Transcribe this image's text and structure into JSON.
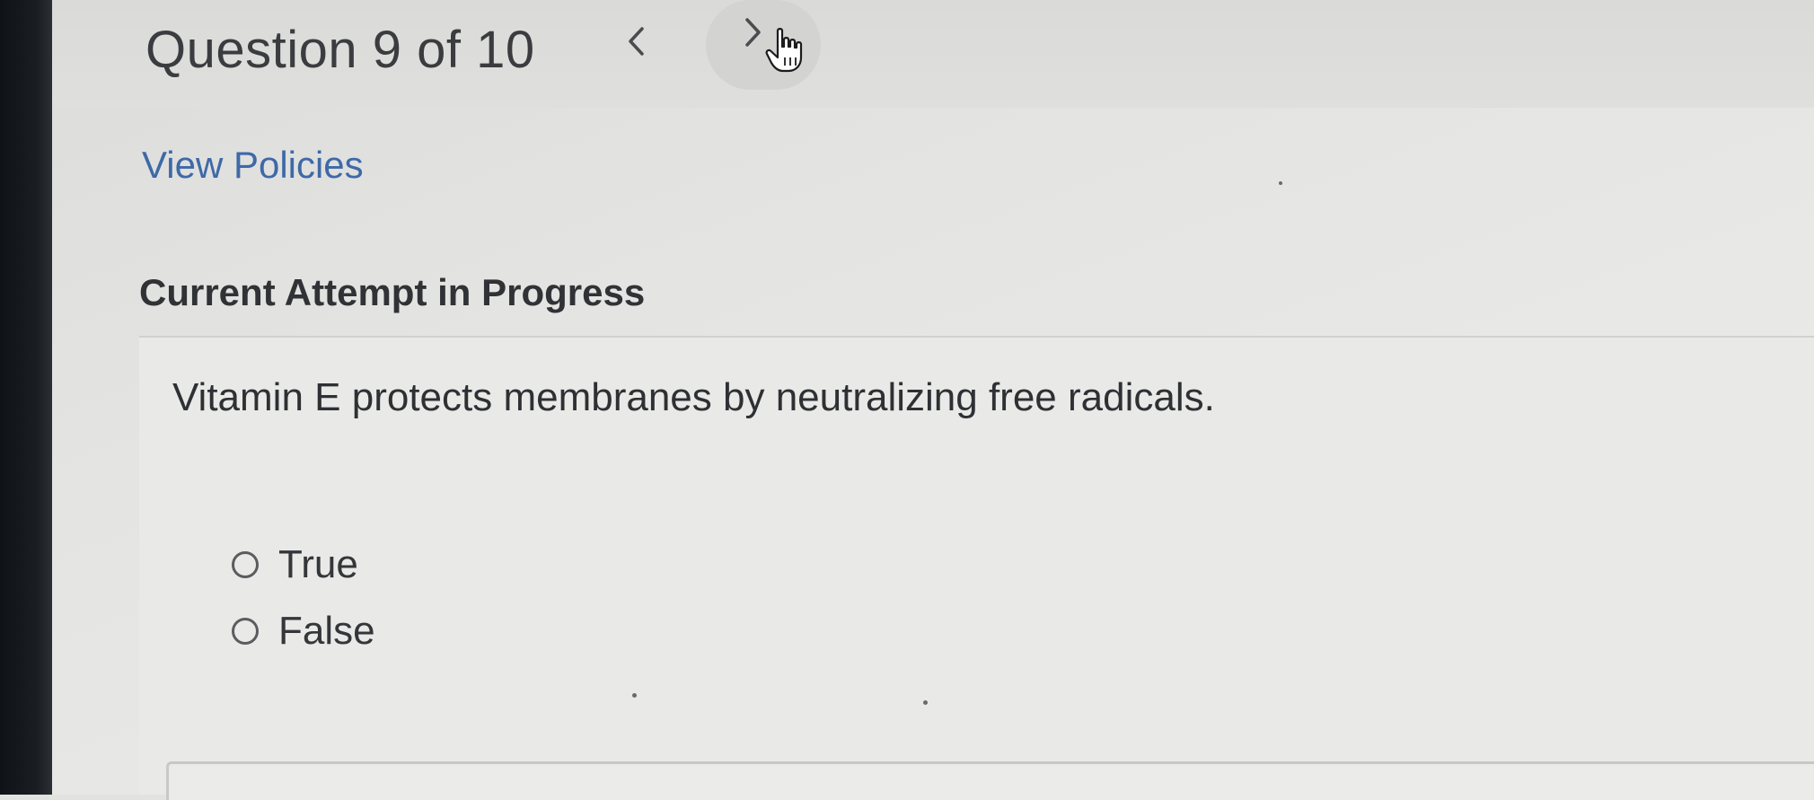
{
  "header": {
    "question_title": "Question 9 of 10",
    "prev_icon": "chevron-left-icon",
    "next_icon": "chevron-right-icon",
    "cursor_icon": "hand-pointer-cursor-icon"
  },
  "links": {
    "view_policies": "View Policies"
  },
  "attempt": {
    "heading": "Current Attempt in Progress"
  },
  "question": {
    "text": "Vitamin E protects membranes by neutralizing free radicals.",
    "options": [
      {
        "label": "True",
        "selected": false
      },
      {
        "label": "False",
        "selected": false
      }
    ]
  },
  "colors": {
    "link": "#3e69a8",
    "text": "#303236",
    "background": "#e4e4e2",
    "bezel": "#14171b"
  }
}
